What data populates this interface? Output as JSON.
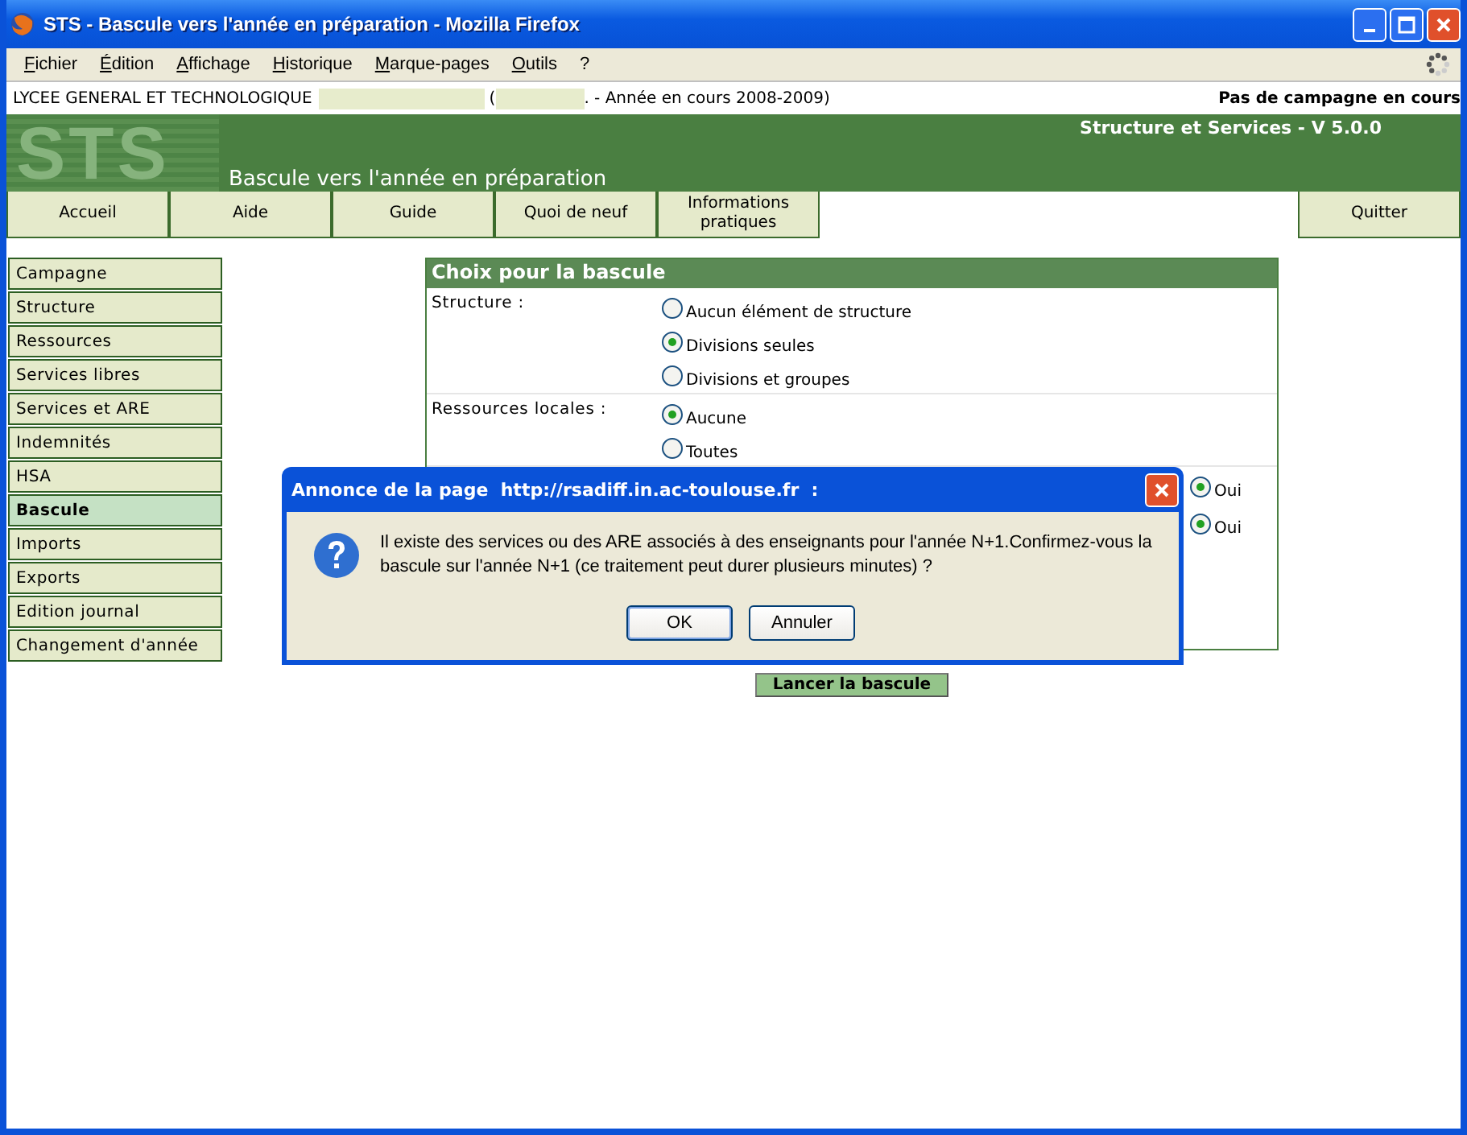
{
  "window": {
    "title": "STS - Bascule vers l'année en préparation - Mozilla Firefox"
  },
  "menu": [
    "Fichier",
    "Édition",
    "Affichage",
    "Historique",
    "Marque-pages",
    "Outils",
    "?"
  ],
  "info_bar": {
    "school": "LYCEE GENERAL ET TECHNOLOGIQUE",
    "open_paren": "(",
    "year": ". - Année en cours 2008-2009)",
    "campaign": "Pas de campagne en cours"
  },
  "header": {
    "logo": "STS",
    "app": "Structure et Services - V 5.0.0",
    "page_title": "Bascule vers l'année en préparation"
  },
  "nav_tabs": [
    {
      "label": "Accueil"
    },
    {
      "label": "Aide"
    },
    {
      "label": "Guide"
    },
    {
      "label": "Quoi de neuf"
    },
    {
      "label": "Informations pratiques"
    }
  ],
  "nav_right": {
    "label": "Quitter"
  },
  "sidebar": {
    "items": [
      {
        "label": "Campagne",
        "selected": false
      },
      {
        "label": "Structure",
        "selected": false
      },
      {
        "label": "Ressources",
        "selected": false
      },
      {
        "label": "Services libres",
        "selected": false
      },
      {
        "label": "Services et ARE",
        "selected": false
      },
      {
        "label": "Indemnités",
        "selected": false
      },
      {
        "label": "HSA",
        "selected": false
      },
      {
        "label": "Bascule",
        "selected": true
      },
      {
        "label": "Imports",
        "selected": false
      },
      {
        "label": "Exports",
        "selected": false
      },
      {
        "label": "Edition journal",
        "selected": false
      },
      {
        "label": "Changement d'année",
        "selected": false
      }
    ]
  },
  "form": {
    "title": "Choix pour la bascule",
    "rows": [
      {
        "label": "Structure :",
        "options": [
          {
            "label": "Aucun élément de structure",
            "selected": false
          },
          {
            "label": "Divisions seules",
            "selected": true
          },
          {
            "label": "Divisions et groupes",
            "selected": false
          }
        ]
      },
      {
        "label": "Ressources locales :",
        "options": [
          {
            "label": "Aucune",
            "selected": true
          },
          {
            "label": "Toutes",
            "selected": false
          }
        ]
      },
      {
        "options": [
          {
            "label": "Oui",
            "selected": true
          }
        ]
      },
      {
        "options": [
          {
            "label": "Oui",
            "selected": true
          }
        ]
      }
    ],
    "submit": "Lancer la bascule"
  },
  "dialog": {
    "title": "Annonce de la page  http://rsadiff.in.ac-toulouse.fr  :",
    "message": "Il existe des services ou des ARE associés à des enseignants pour l'année N+1.Confirmez-vous la bascule sur l'année N+1 (ce traitement peut durer plusieurs minutes) ?",
    "buttons": [
      "OK",
      "Annuler"
    ]
  }
}
